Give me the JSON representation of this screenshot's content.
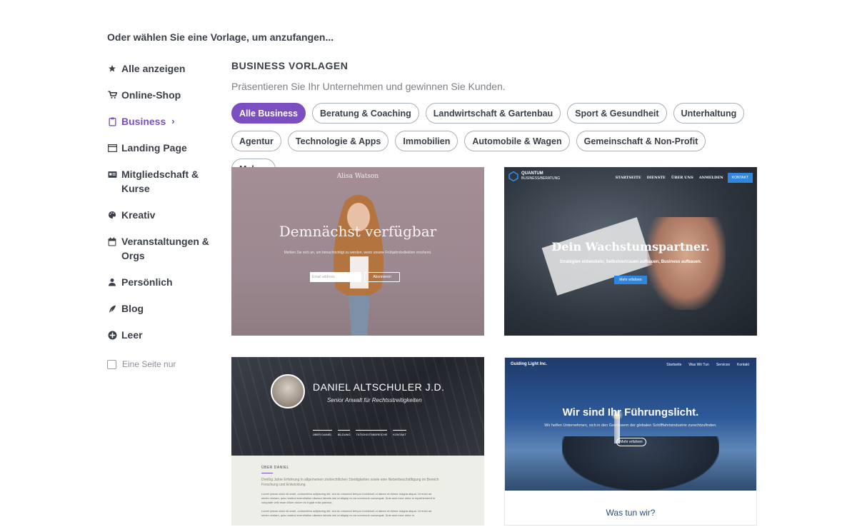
{
  "intro": "Oder wählen Sie eine Vorlage, um anzufangen...",
  "sidebar": {
    "items": [
      {
        "label": "Alle anzeigen",
        "icon": "star-icon"
      },
      {
        "label": "Online-Shop",
        "icon": "cart-icon"
      },
      {
        "label": "Business",
        "icon": "clipboard-icon",
        "chevron": "›"
      },
      {
        "label": "Landing Page",
        "icon": "window-icon"
      },
      {
        "label": "Mitgliedschaft &",
        "label2": "Kurse",
        "icon": "id-card-icon"
      },
      {
        "label": "Kreativ",
        "icon": "palette-icon"
      },
      {
        "label": "Veranstaltungen &",
        "label2": "Orgs",
        "icon": "calendar-icon"
      },
      {
        "label": "Persönlich",
        "icon": "person-icon"
      },
      {
        "label": "Blog",
        "icon": "quill-icon"
      },
      {
        "label": "Leer",
        "icon": "plus-circle-icon"
      }
    ],
    "only_page": "Eine Seite nur"
  },
  "main": {
    "title": "BUSINESS VORLAGEN",
    "subtitle": "Präsentieren Sie Ihr Unternehmen und gewinnen Sie Kunden.",
    "chips": [
      "Alle Business",
      "Beratung & Coaching",
      "Landwirtschaft & Gartenbau",
      "Sport & Gesundheit",
      "Unterhaltung",
      "Agentur",
      "Technologie & Apps",
      "Immobilien",
      "Automobile & Wagen",
      "Gemeinschaft & Non-Profit",
      "Mehr..."
    ]
  },
  "cards": {
    "c1": {
      "name": "Alisa Watson",
      "title": "Demnächst verfügbar",
      "text": "Melden Sie sich an, um benachrichtigt zu werden, wenn unsere Frühjahrskollektion erscheint.",
      "input_placeholder": "Email address",
      "button": "Abonnieren"
    },
    "c2": {
      "logo": "QUANTUM",
      "logo_sub": "BUSINESS/BERATUNG",
      "nav": [
        "STARTSEITE",
        "DIENSTE",
        "ÜBER UNS",
        "ANMELDEN"
      ],
      "cta": "KONTAKT",
      "title": "Dein Wachstumspartner.",
      "subtitle": "Strategien entwickeln, Selbstvertrauen aufbauen, Business aufbauen.",
      "button": "Mehr erfahren"
    },
    "c3": {
      "name": "DANIEL ALTSCHULER J.D.",
      "role": "Senior Anwalt für Rechtsstreitigkeiten",
      "nav": [
        "ÜBER DANIEL",
        "BILDUNG",
        "TÄTIGKEITSBEREICHE",
        "KONTAKT"
      ],
      "label": "ÜBER DANIEL",
      "intro": "Dreißig Jahre Erfahrung in allgemeinen zivilrechtlichen Streitigkeiten sowie eine Nebenbeschäftigung im Bereich Forschung und Entwicklung.",
      "lorem": "Lorem ipsum dolor sit amet, consectetur adipiscing elit, sed do eiusmod tempor incididunt ut labore et dolore magna aliqua. Ut enim ad minim veniam, quis nostrud exercitation ullamco laboris nisi ut aliquip ex ea commodo consequat. Duis aute irure dolor in reprehenderit in voluptate velit esse cillum dolore eu fugiat nulla pariatur.",
      "lorem2": "Lorem ipsum dolor sit amet, consectetur adipiscing elit, sed do eiusmod tempor incididunt ut labore et dolore magna aliqua. Ut enim ad minim veniam, quis nostrud exercitation ullamco laboris nisi ut aliquip ex ea commodo consequat. Duis aute irure dolor in."
    },
    "c4": {
      "logo": "Guiding Light Inc.",
      "nav": [
        "Startseite",
        "Was Wir Tun",
        "Services",
        "Kontakt"
      ],
      "title": "Wir sind Ihr Führungslicht.",
      "subtitle": "Wir helfen Unternehmen, sich in den Gewässern der globalen Schifffahrtsindustrie zurechtzufinden.",
      "button": "Mehr erfahren",
      "question": "Was tun wir?"
    }
  },
  "colors": {
    "accent": "#7b4fc1",
    "text": "#3a3f47",
    "muted": "#7a7f87",
    "cta_blue": "#2e86de"
  }
}
